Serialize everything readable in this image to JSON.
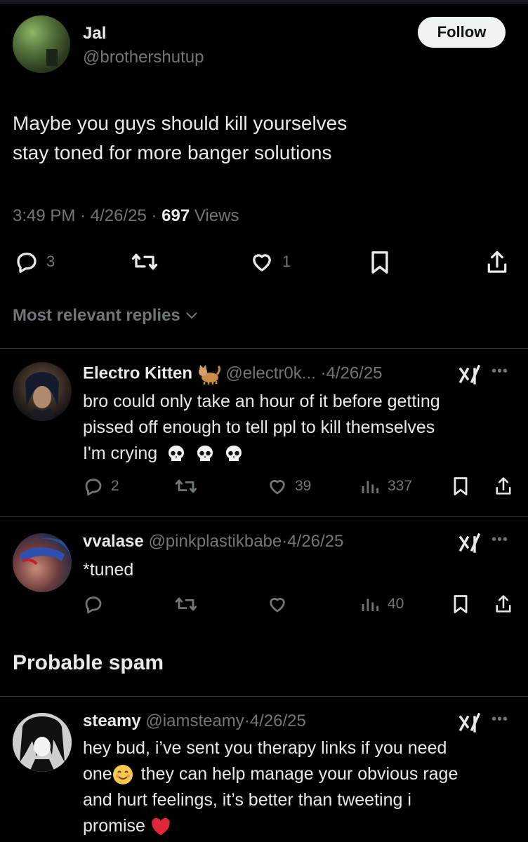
{
  "post": {
    "author_name": "Jal",
    "author_handle": "@brothershutup",
    "follow_label": "Follow",
    "text_line1": "Maybe you guys should kill yourselves",
    "text_line2": "stay toned for more banger solutions",
    "time": "3:49 PM",
    "date": "4/26/25",
    "views_count": "697",
    "views_label": "Views",
    "replies": "3",
    "likes": "1"
  },
  "replies_sort_label": "Most relevant replies",
  "replies": [
    {
      "name": "Electro Kitten",
      "handle": "@electr0k...",
      "date": "4/26/25",
      "line1": "bro could only take an hour of it before getting",
      "line2": "pissed off enough to tell ppl to kill themselves",
      "line3": "I'm crying",
      "replies": "2",
      "likes": "39",
      "views": "337"
    },
    {
      "name": "vvalase",
      "handle": "@pinkplastikbabe",
      "date": "4/26/25",
      "line1": "*tuned",
      "views": "40"
    }
  ],
  "spam_label": "Probable spam",
  "spam_reply": {
    "name": "steamy",
    "handle": "@iamsteamy",
    "date": "4/26/25",
    "line1": "hey bud, i’ve sent you therapy links if you need",
    "line2a": "one",
    "line2b": "they can help manage your obvious rage",
    "line3": "and hurt feelings, it’s better than tweeting i",
    "line4": "promise"
  },
  "colors": {
    "bg": "#000000",
    "text": "#e7e9ea",
    "muted": "#71767b",
    "divider": "#2f3336",
    "follow_bg": "#eff3f4"
  },
  "icons": [
    "reply-icon",
    "repost-icon",
    "like-icon",
    "bookmark-icon",
    "share-icon",
    "views-icon",
    "grok-icon",
    "more-icon",
    "chevron-down-icon",
    "skull-emoji",
    "smile-emoji",
    "red-heart-emoji",
    "cat-emoji"
  ]
}
